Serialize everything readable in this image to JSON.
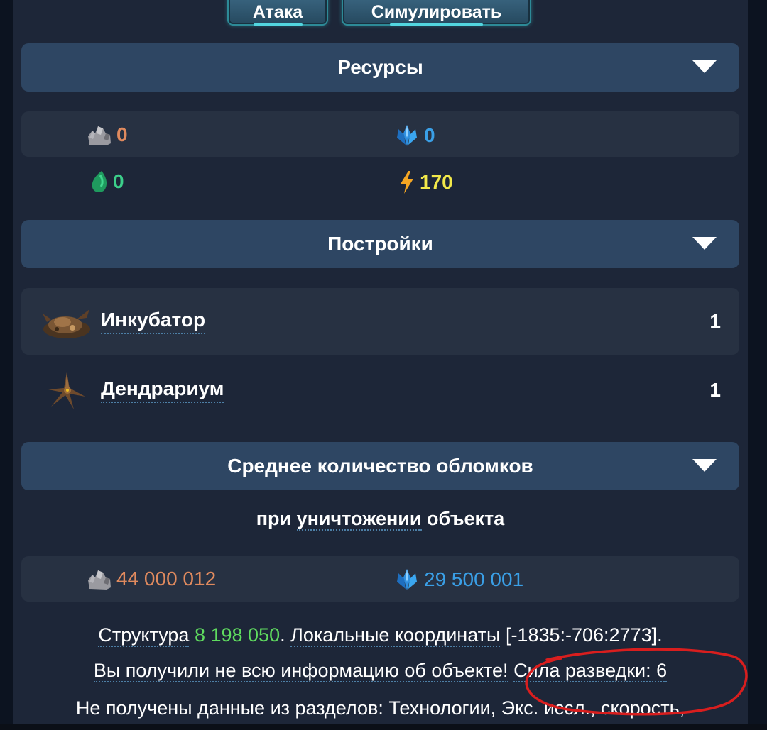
{
  "buttons": {
    "attack_label": "Атака",
    "simulate_label": "Симулировать"
  },
  "resources": {
    "header": "Ресурсы",
    "metal": "0",
    "crystal": "0",
    "organics": "0",
    "energy": "170"
  },
  "buildings": {
    "header": "Постройки",
    "items": [
      {
        "name": "Инкубатор",
        "count": "1"
      },
      {
        "name": "Дендрариум",
        "count": "1"
      }
    ]
  },
  "debris": {
    "header": "Среднее количество обломков",
    "subtitle_prefix": "при ",
    "subtitle_link": "уничтожении",
    "subtitle_suffix": " объекта",
    "metal": "44 000 012",
    "crystal": "29 500 001"
  },
  "info": {
    "structure_label": "Структура",
    "structure_value": "8 198 050",
    "coords_label": "Локальные координаты",
    "coords_value": "[-1835:-706:2773]",
    "incomplete_text": "Вы получили не всю информацию об объекте!",
    "scout_text": "Сила разведки: 6",
    "missing_text": "Не получены данные из разделов: Технологии, Экс. иссл., скорость,"
  },
  "colors": {
    "metal": "#e08a5e",
    "crystal": "#3a9fe6",
    "organics": "#3ccf8a",
    "energy": "#f3e94a",
    "structure_value": "#5fdb5f",
    "annotation": "#d91e1e"
  },
  "icons": {
    "metal": "metal-ore-icon",
    "crystal": "crystal-icon",
    "organics": "organics-drop-icon",
    "energy": "lightning-icon",
    "incubator": "incubator-building-icon",
    "dendrarium": "dendrarium-building-icon"
  }
}
